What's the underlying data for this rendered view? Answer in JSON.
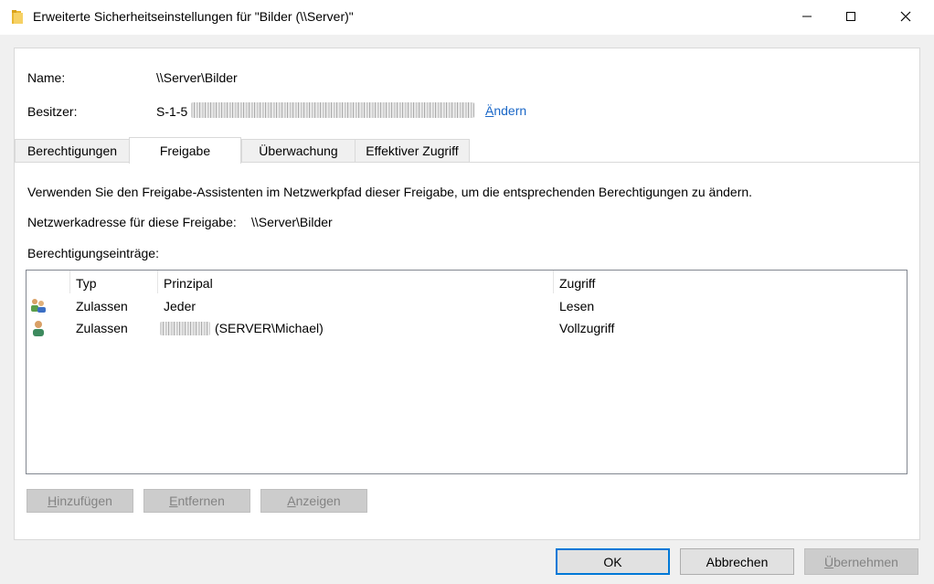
{
  "window": {
    "title": "Erweiterte Sicherheitseinstellungen für \"Bilder (\\\\Server)\""
  },
  "name_label": "Name:",
  "name_value": "\\\\Server\\Bilder",
  "owner_label": "Besitzer:",
  "owner_value": "S-1-5",
  "owner_change_first": "Ä",
  "owner_change_rest": "ndern",
  "tabs": [
    {
      "label": "Berechtigungen"
    },
    {
      "label": "Freigabe"
    },
    {
      "label": "Überwachung"
    },
    {
      "label": "Effektiver Zugriff"
    }
  ],
  "info_text": "Verwenden Sie den Freigabe-Assistenten im Netzwerkpfad dieser Freigabe, um die entsprechenden Berechtigungen zu ändern.",
  "network_label": "Netzwerkadresse für diese Freigabe:",
  "network_value": "\\\\Server\\Bilder",
  "entries_label": "Berechtigungseinträge:",
  "columns": {
    "type": "Typ",
    "principal": "Prinzipal",
    "access": "Zugriff"
  },
  "rows": [
    {
      "type": "Zulassen",
      "principal": "Jeder",
      "access": "Lesen",
      "icon": "users-group-icon"
    },
    {
      "type": "Zulassen",
      "principal": "(SERVER\\Michael)",
      "access": "Vollzugriff",
      "icon": "user-icon"
    }
  ],
  "buttons": {
    "add_first": "H",
    "add_rest": "inzufügen",
    "remove_first": "E",
    "remove_rest": "ntfernen",
    "view_first": "A",
    "view_rest": "nzeigen",
    "ok": "OK",
    "cancel": "Abbrechen",
    "apply_first": "Ü",
    "apply_rest": "bernehmen"
  },
  "colors": {
    "link": "#1a67c7",
    "default_button_border": "#0078d7"
  }
}
